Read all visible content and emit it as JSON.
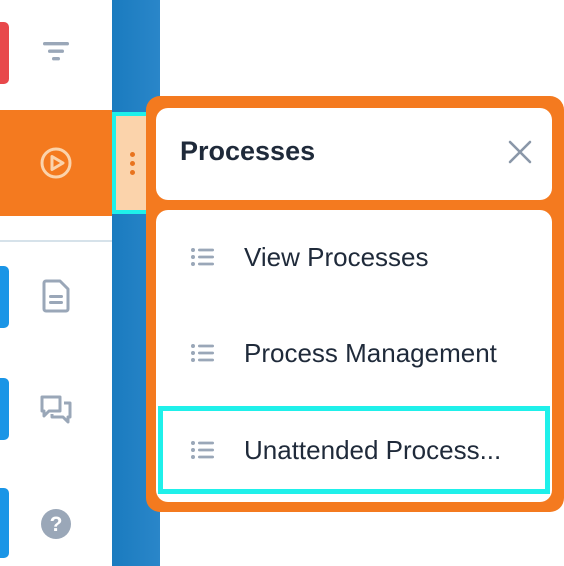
{
  "rail": {
    "items": [
      {
        "icon": "filter-icon",
        "accent": "#e8484b",
        "active": false
      },
      {
        "icon": "play-circle-icon",
        "accent": "",
        "active": true
      },
      {
        "icon": "document-icon",
        "accent": "#1a95e6",
        "active": false
      },
      {
        "icon": "chat-icon",
        "accent": "#1a95e6",
        "active": false
      },
      {
        "icon": "help-icon",
        "accent": "#1a95e6",
        "active": false
      }
    ]
  },
  "colors": {
    "brand_orange": "#f47a1f",
    "highlight_cyan": "#1ff0ea",
    "rail_blue": "#1a7bbf",
    "text_dark": "#1f2a3a",
    "icon_gray": "#9aa7b8"
  },
  "popover": {
    "title": "Processes",
    "items": [
      {
        "label": "View Processes",
        "icon": "list-icon"
      },
      {
        "label": "Process Management",
        "icon": "list-icon"
      },
      {
        "label": "Unattended Process...",
        "icon": "list-icon"
      }
    ]
  }
}
